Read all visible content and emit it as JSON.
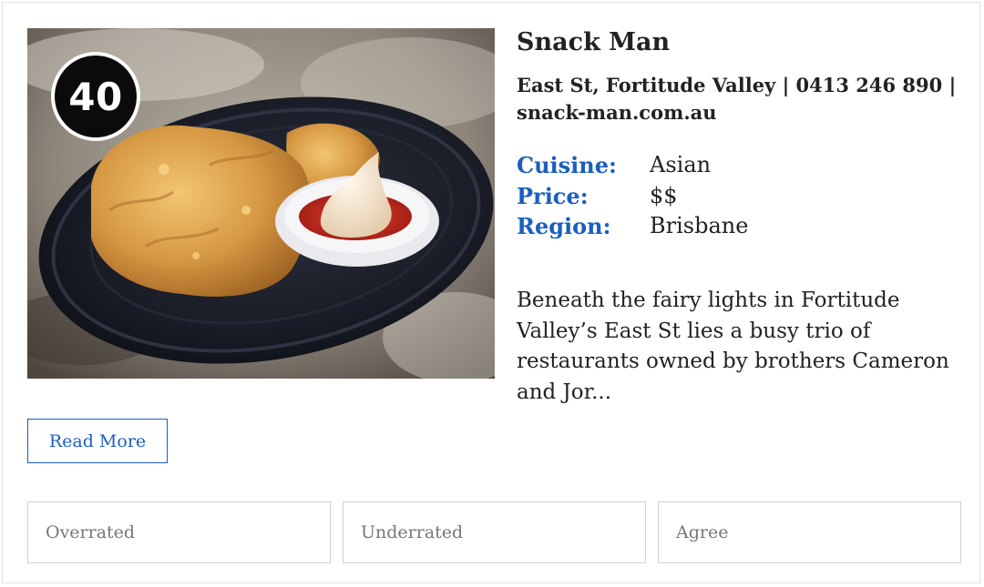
{
  "listing": {
    "rank": "40",
    "title": "Snack Man",
    "contact_line_1": "East St, Fortitude Valley | 0413 246 890 |",
    "website": "snack-man.com.au",
    "details": [
      {
        "label": "Cuisine:",
        "value": "Asian"
      },
      {
        "label": "Price:",
        "value": "$$"
      },
      {
        "label": "Region:",
        "value": "Brisbane"
      }
    ],
    "description": "Beneath the fairy lights in Fortitude Valley’s East St lies a busy trio of restaurants owned by brothers Cameron and Jor...",
    "read_more_label": "Read More"
  },
  "votes": {
    "overrated": "Overrated",
    "underrated": "Underrated",
    "agree": "Agree"
  },
  "colors": {
    "accent": "#1a5fc0",
    "badge": "#0b0b0b",
    "border": "#cfcfcf"
  },
  "icons": {
    "rank": "rank-badge"
  }
}
